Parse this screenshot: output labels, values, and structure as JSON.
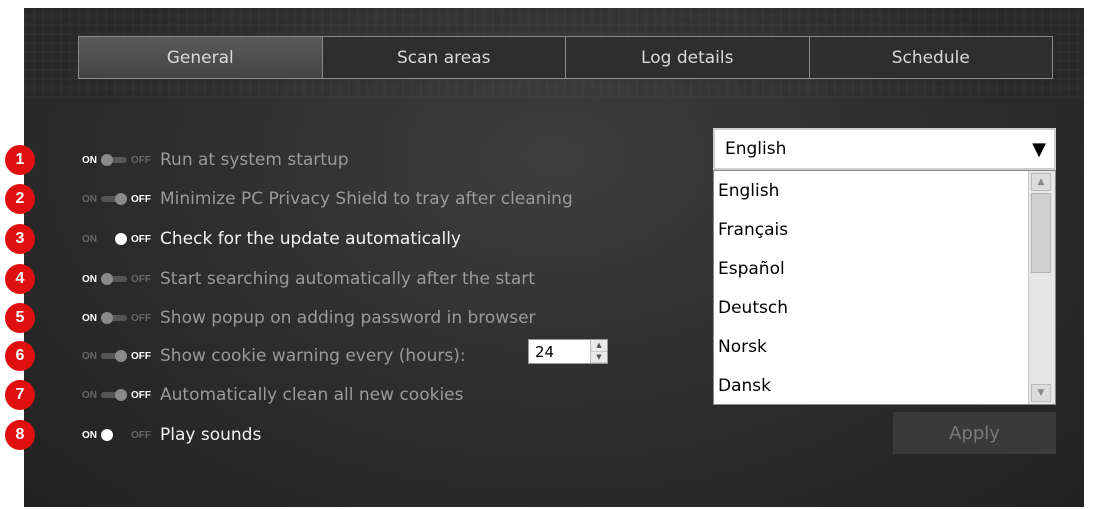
{
  "tabs": [
    {
      "label": "General",
      "active": true
    },
    {
      "label": "Scan areas",
      "active": false
    },
    {
      "label": "Log details",
      "active": false
    },
    {
      "label": "Schedule",
      "active": false
    }
  ],
  "toggle_text": {
    "on": "ON",
    "off": "OFF"
  },
  "settings": [
    {
      "badge": "1",
      "label": "Run at system startup",
      "state": "on"
    },
    {
      "badge": "2",
      "label": "Minimize PC Privacy Shield to tray after cleaning",
      "state": "off"
    },
    {
      "badge": "3",
      "label": "Check for the update automatically",
      "state": "off"
    },
    {
      "badge": "4",
      "label": "Start searching automatically after the start",
      "state": "on"
    },
    {
      "badge": "5",
      "label": "Show popup on adding password in browser",
      "state": "on"
    },
    {
      "badge": "6",
      "label": "Show cookie warning every (hours):",
      "state": "off"
    },
    {
      "badge": "7",
      "label": "Automatically clean all new cookies",
      "state": "off"
    },
    {
      "badge": "8",
      "label": "Play sounds",
      "state": "on"
    }
  ],
  "cookie_hours": "24",
  "language": {
    "selected": "English",
    "options": [
      "English",
      "Français",
      "Español",
      "Deutsch",
      "Norsk",
      "Dansk"
    ]
  },
  "apply_label": "Apply",
  "colors": {
    "badge": "#e01010",
    "panel": "#2c2c2c"
  }
}
